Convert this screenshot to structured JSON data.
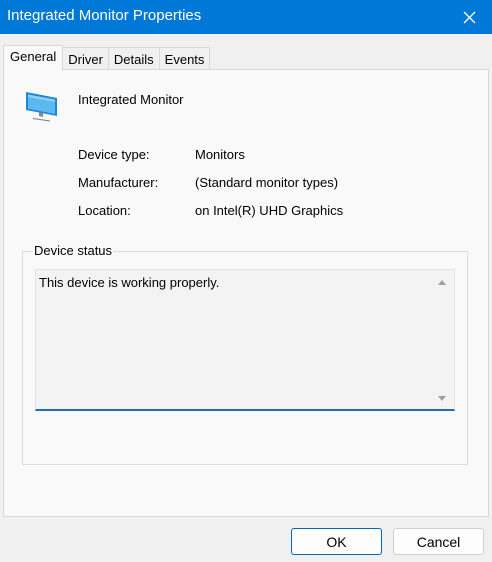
{
  "window": {
    "title": "Integrated Monitor Properties",
    "close_label": "Close"
  },
  "tabs": [
    {
      "label": "General",
      "active": true
    },
    {
      "label": "Driver",
      "active": false
    },
    {
      "label": "Details",
      "active": false
    },
    {
      "label": "Events",
      "active": false
    }
  ],
  "device": {
    "name": "Integrated Monitor",
    "icon": "monitor-icon",
    "properties": [
      {
        "label": "Device type:",
        "value": "Monitors"
      },
      {
        "label": "Manufacturer:",
        "value": "(Standard monitor types)"
      },
      {
        "label": "Location:",
        "value": "on Intel(R) UHD Graphics"
      }
    ]
  },
  "status": {
    "legend": "Device status",
    "text": "This device is working properly."
  },
  "buttons": {
    "ok": "OK",
    "cancel": "Cancel"
  },
  "colors": {
    "titlebar": "#0078d7",
    "accent": "#1f6fb5"
  }
}
